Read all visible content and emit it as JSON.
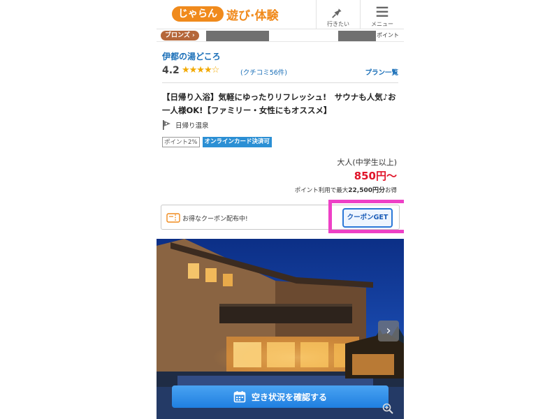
{
  "header": {
    "logo_badge": "じゃらん",
    "logo_text": "遊び·体験",
    "want_label": "行きたい",
    "menu_label": "メニュー"
  },
  "rank": {
    "badge": "ブロンズ ›",
    "points_label": "ポイント"
  },
  "facility": {
    "name": "伊都の湯どころ",
    "rating": "4.2",
    "stars_filled": 4,
    "reviews": "(クチコミ56件)",
    "plans_link": "プラン一覧"
  },
  "plan": {
    "title": "【日帰り入浴】気軽にゆったりリフレッシュ!　サウナも人気♪お一人様OK!【ファミリー・女性にもオススメ】",
    "category": "日帰り温泉",
    "tag_point": "ポイント2%",
    "tag_card": "オンラインカード決済可"
  },
  "price": {
    "label": "大人(中学生以上)",
    "value": "850円〜",
    "note_prefix": "ポイント利用で最大",
    "note_amount": "22,500円分",
    "note_suffix": "お得"
  },
  "coupon": {
    "text": "お得なクーポン配布中!",
    "button": "クーポンGET"
  },
  "photo": {
    "next": "›",
    "cta": "空き状況を確認する"
  },
  "colors": {
    "brand_orange": "#f08a1c",
    "link_blue": "#1a6fb8",
    "price_red": "#e0152a",
    "highlight_pink": "#ee40c6",
    "cta_blue": "#1f7fe0"
  }
}
